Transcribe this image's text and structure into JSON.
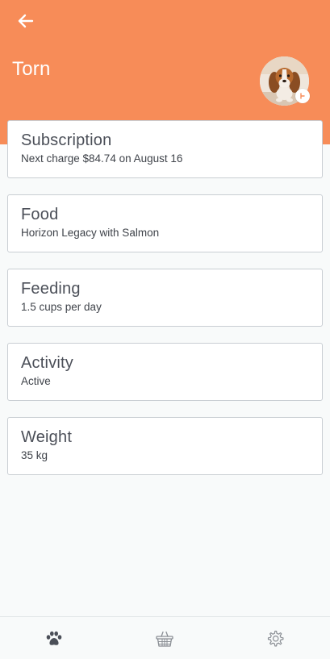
{
  "header": {
    "back_icon": "arrow-left-icon",
    "pet_name": "Torn",
    "avatar": "beagle-puppy-photo",
    "avatar_badge_icon": "edit-icon",
    "color": "#f78c58"
  },
  "cards": [
    {
      "title": "Subscription",
      "subtitle": "Next charge $84.74 on August 16"
    },
    {
      "title": "Food",
      "subtitle": "Horizon Legacy with Salmon"
    },
    {
      "title": "Feeding",
      "subtitle": "1.5 cups per day"
    },
    {
      "title": "Activity",
      "subtitle": "Active"
    },
    {
      "title": "Weight",
      "subtitle": "35 kg"
    }
  ],
  "tabbar": {
    "items": [
      {
        "icon": "paw-icon",
        "active": true
      },
      {
        "icon": "basket-icon",
        "active": false
      },
      {
        "icon": "gear-icon",
        "active": false
      }
    ]
  }
}
